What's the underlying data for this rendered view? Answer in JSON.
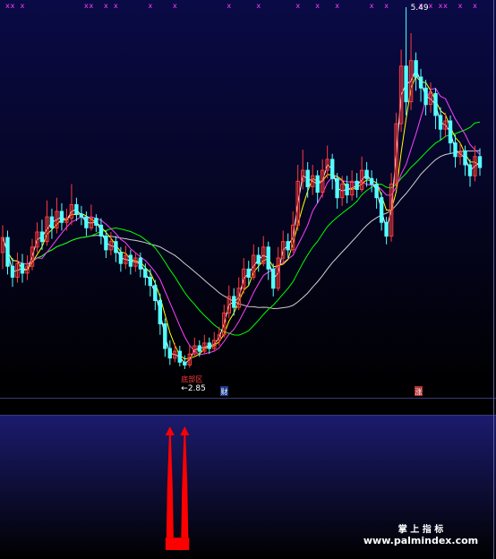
{
  "chart_data": [
    {
      "type": "candlestick",
      "panel": "price",
      "top_markers": {
        "glyph": "x",
        "color": "#ff3cff",
        "indices": [
          1,
          2,
          4,
          17,
          18,
          21,
          23,
          30,
          35,
          46,
          52,
          60,
          64,
          68,
          75,
          78,
          85,
          87,
          89,
          90,
          93,
          96
        ]
      },
      "annotations": {
        "high_label": "5.49",
        "low_label": "←2.85",
        "low_marker_text": "底部区",
        "badge_left": "财",
        "badge_right": "涨"
      },
      "candles": [
        [
          3.7,
          3.81,
          3.9,
          3.58
        ],
        [
          3.81,
          3.6,
          3.86,
          3.54
        ],
        [
          3.6,
          3.52,
          3.66,
          3.45
        ],
        [
          3.52,
          3.62,
          3.7,
          3.48
        ],
        [
          3.62,
          3.55,
          3.69,
          3.48
        ],
        [
          3.55,
          3.6,
          3.68,
          3.5
        ],
        [
          3.6,
          3.74,
          3.8,
          3.57
        ],
        [
          3.74,
          3.85,
          3.92,
          3.7
        ],
        [
          3.85,
          3.78,
          3.94,
          3.72
        ],
        [
          3.78,
          3.96,
          4.08,
          3.75
        ],
        [
          3.96,
          3.88,
          4.02,
          3.8
        ],
        [
          3.88,
          4.0,
          4.1,
          3.84
        ],
        [
          4.0,
          3.92,
          4.06,
          3.86
        ],
        [
          3.92,
          3.95,
          4.02,
          3.86
        ],
        [
          3.95,
          4.05,
          4.2,
          3.9
        ],
        [
          4.05,
          3.98,
          4.1,
          3.93
        ],
        [
          3.98,
          3.96,
          4.04,
          3.9
        ],
        [
          3.96,
          3.88,
          4.0,
          3.82
        ],
        [
          3.88,
          3.95,
          4.05,
          3.86
        ],
        [
          3.95,
          3.9,
          3.98,
          3.85
        ],
        [
          3.9,
          3.82,
          3.95,
          3.76
        ],
        [
          3.82,
          3.72,
          3.86,
          3.66
        ],
        [
          3.72,
          3.78,
          3.85,
          3.68
        ],
        [
          3.78,
          3.7,
          3.82,
          3.63
        ],
        [
          3.7,
          3.62,
          3.74,
          3.56
        ],
        [
          3.62,
          3.68,
          3.75,
          3.58
        ],
        [
          3.68,
          3.6,
          3.72,
          3.54
        ],
        [
          3.6,
          3.66,
          3.7,
          3.56
        ],
        [
          3.66,
          3.58,
          3.7,
          3.52
        ],
        [
          3.58,
          3.52,
          3.62,
          3.46
        ],
        [
          3.52,
          3.46,
          3.58,
          3.38
        ],
        [
          3.46,
          3.35,
          3.5,
          3.28
        ],
        [
          3.35,
          3.18,
          3.4,
          3.1
        ],
        [
          3.18,
          3.0,
          3.22,
          2.94
        ],
        [
          3.0,
          2.93,
          3.06,
          2.88
        ],
        [
          2.93,
          2.98,
          3.04,
          2.9
        ],
        [
          2.98,
          2.9,
          3.02,
          2.87
        ],
        [
          2.9,
          2.88,
          2.95,
          2.85
        ],
        [
          2.88,
          2.96,
          3.02,
          2.86
        ],
        [
          2.96,
          3.02,
          3.08,
          2.94
        ],
        [
          3.02,
          2.98,
          3.06,
          2.94
        ],
        [
          2.98,
          3.04,
          3.1,
          2.96
        ],
        [
          3.04,
          3.0,
          3.08,
          2.96
        ],
        [
          3.0,
          3.06,
          3.12,
          2.98
        ],
        [
          3.06,
          3.1,
          3.16,
          3.02
        ],
        [
          3.1,
          3.26,
          3.32,
          3.08
        ],
        [
          3.26,
          3.38,
          3.46,
          3.22
        ],
        [
          3.38,
          3.3,
          3.44,
          3.24
        ],
        [
          3.3,
          3.44,
          3.52,
          3.28
        ],
        [
          3.44,
          3.58,
          3.66,
          3.4
        ],
        [
          3.58,
          3.52,
          3.64,
          3.46
        ],
        [
          3.52,
          3.68,
          3.76,
          3.5
        ],
        [
          3.68,
          3.62,
          3.74,
          3.56
        ],
        [
          3.62,
          3.74,
          3.82,
          3.6
        ],
        [
          3.74,
          3.58,
          3.78,
          3.5
        ],
        [
          3.58,
          3.44,
          3.62,
          3.38
        ],
        [
          3.44,
          3.66,
          3.74,
          3.42
        ],
        [
          3.66,
          3.78,
          3.86,
          3.62
        ],
        [
          3.78,
          3.72,
          3.84,
          3.66
        ],
        [
          3.72,
          3.9,
          4.0,
          3.7
        ],
        [
          3.9,
          4.22,
          4.34,
          3.86
        ],
        [
          4.22,
          4.3,
          4.45,
          4.16
        ],
        [
          4.3,
          4.18,
          4.36,
          4.1
        ],
        [
          4.18,
          4.26,
          4.34,
          4.12
        ],
        [
          4.26,
          4.14,
          4.3,
          4.06
        ],
        [
          4.14,
          4.3,
          4.38,
          4.1
        ],
        [
          4.3,
          4.38,
          4.48,
          4.24
        ],
        [
          4.38,
          4.24,
          4.42,
          4.16
        ],
        [
          4.24,
          4.1,
          4.28,
          4.02
        ],
        [
          4.1,
          4.2,
          4.26,
          4.04
        ],
        [
          4.2,
          4.12,
          4.26,
          4.06
        ],
        [
          4.12,
          4.22,
          4.3,
          4.08
        ],
        [
          4.22,
          4.16,
          4.28,
          4.1
        ],
        [
          4.16,
          4.3,
          4.4,
          4.14
        ],
        [
          4.3,
          4.24,
          4.36,
          4.18
        ],
        [
          4.24,
          4.2,
          4.3,
          4.14
        ],
        [
          4.2,
          4.1,
          4.24,
          4.02
        ],
        [
          4.1,
          3.92,
          4.14,
          3.86
        ],
        [
          3.92,
          3.82,
          3.96,
          3.76
        ],
        [
          3.82,
          4.2,
          4.28,
          3.78
        ],
        [
          4.2,
          4.64,
          4.72,
          4.16
        ],
        [
          4.64,
          5.06,
          5.18,
          4.58
        ],
        [
          5.06,
          4.8,
          5.49,
          4.7
        ],
        [
          4.8,
          5.1,
          5.3,
          4.74
        ],
        [
          5.1,
          4.98,
          5.16,
          4.88
        ],
        [
          4.98,
          4.9,
          5.04,
          4.8
        ],
        [
          4.9,
          4.78,
          4.96,
          4.7
        ],
        [
          4.78,
          4.86,
          4.94,
          4.72
        ],
        [
          4.86,
          4.7,
          4.9,
          4.6
        ],
        [
          4.7,
          4.6,
          4.76,
          4.52
        ],
        [
          4.6,
          4.66,
          4.72,
          4.54
        ],
        [
          4.66,
          4.5,
          4.7,
          4.42
        ],
        [
          4.5,
          4.4,
          4.56,
          4.32
        ],
        [
          4.4,
          4.44,
          4.5,
          4.34
        ],
        [
          4.44,
          4.34,
          4.48,
          4.26
        ],
        [
          4.34,
          4.26,
          4.38,
          4.18
        ],
        [
          4.26,
          4.4,
          4.48,
          4.22
        ],
        [
          4.4,
          4.32,
          4.46,
          4.26
        ]
      ]
    },
    {
      "type": "bar",
      "panel": "indicator",
      "signals": [
        {
          "index": 34,
          "value": 1.0
        },
        {
          "index": 37,
          "value": 1.0
        }
      ],
      "base_level": 0.1
    }
  ],
  "colors": {
    "up": "#ff3b3b",
    "down": "#54ffff",
    "ma5": "#ffffff",
    "ma10": "#ffff00",
    "ma20": "#ff40ff",
    "ma30": "#00ff00",
    "ma60": "#cfcfcf",
    "marker": "#ff3cff",
    "signal": "#ff0000"
  },
  "watermark": {
    "line1": "掌 上 指 标",
    "line2": "www.palmindex.com"
  }
}
